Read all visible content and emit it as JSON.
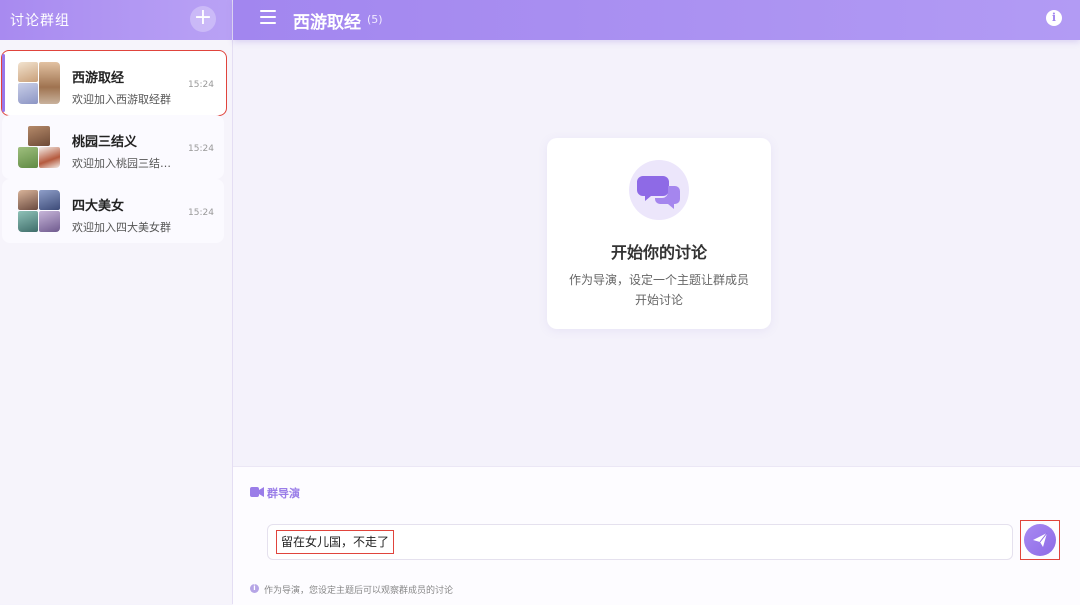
{
  "sidebar": {
    "title": "讨论群组",
    "add_label": "+",
    "groups": [
      {
        "name": "西游取经",
        "preview": "欢迎加入西游取经群",
        "time": "15:24",
        "active": true
      },
      {
        "name": "桃园三结义",
        "preview": "欢迎加入桃园三结义群",
        "time": "15:24",
        "active": false
      },
      {
        "name": "四大美女",
        "preview": "欢迎加入四大美女群",
        "time": "15:24",
        "active": false
      }
    ]
  },
  "header": {
    "title": "西游取经",
    "member_count": "(5)",
    "menu_icon": "hamburger-icon",
    "info_icon": "info-icon",
    "info_glyph": "i"
  },
  "empty_state": {
    "icon": "chat-bubbles-icon",
    "title": "开始你的讨论",
    "description": "作为导演，设定一个主题让群成员开始讨论"
  },
  "composer": {
    "role_label": "群导演",
    "role_icon": "video-camera-icon",
    "input_value": "留在女儿国，不走了",
    "send_icon": "paper-plane-icon",
    "hint_glyph": "i",
    "hint": "作为导演，您设定主题后可以观察群成员的讨论"
  },
  "colors": {
    "accent": "#a286ef",
    "accent_dark": "#8e6ae6",
    "highlight_border": "#e0443c"
  }
}
